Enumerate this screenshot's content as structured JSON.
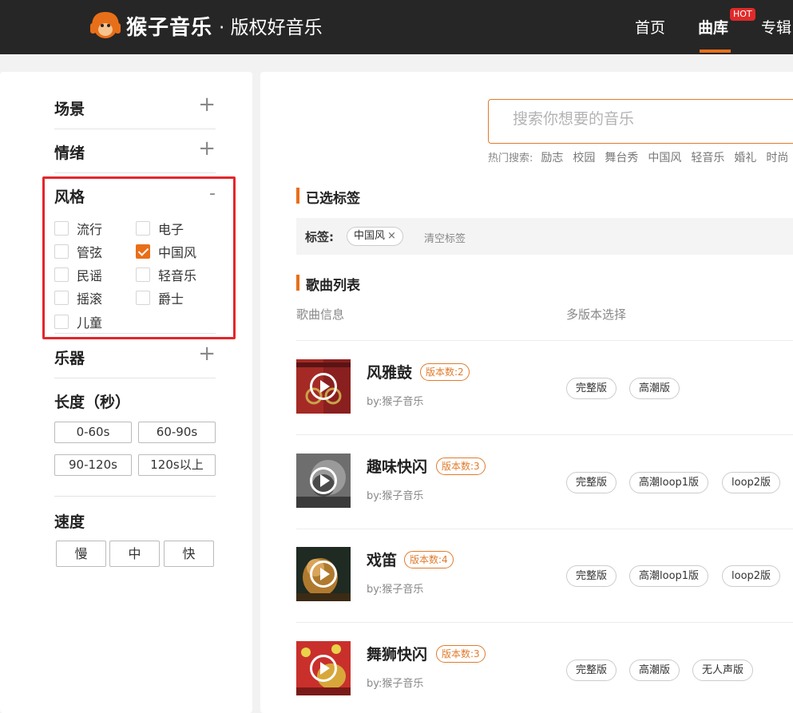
{
  "header": {
    "logo_text": "猴子音乐",
    "slogan": "· 版权好音乐",
    "nav": [
      "首页",
      "曲库",
      "专辑"
    ],
    "hot_badge": "HOT",
    "accent": "#e86f19"
  },
  "sidebar": {
    "scene": {
      "title": "场景",
      "toggle": "+"
    },
    "mood": {
      "title": "情绪",
      "toggle": "+"
    },
    "style": {
      "title": "风格",
      "toggle": "-",
      "options": [
        "流行",
        "电子",
        "管弦",
        "中国风",
        "民谣",
        "轻音乐",
        "摇滚",
        "爵士",
        "儿童"
      ],
      "checked": "中国风"
    },
    "instrument": {
      "title": "乐器",
      "toggle": "+"
    },
    "length": {
      "title": "长度（秒）",
      "options": [
        "0-60s",
        "60-90s",
        "90-120s",
        "120s以上"
      ]
    },
    "speed": {
      "title": "速度",
      "options": [
        "慢",
        "中",
        "快"
      ]
    }
  },
  "main": {
    "search_placeholder": "搜索你想要的音乐",
    "hot_label": "热门搜索:",
    "hot_words": [
      "励志",
      "校园",
      "舞台秀",
      "中国风",
      "轻音乐",
      "婚礼",
      "时尚"
    ],
    "selected_title": "已选标签",
    "tag_label": "标签:",
    "selected_tag": "中国风",
    "tag_close": "×",
    "clear_tags": "清空标签",
    "list_title": "歌曲列表",
    "col_info": "歌曲信息",
    "col_versions": "多版本选择",
    "songs": [
      {
        "name": "风雅鼓",
        "badge": "版本数:2",
        "by": "by:猴子音乐",
        "versions": [
          "完整版",
          "高潮版"
        ]
      },
      {
        "name": "趣味快闪",
        "badge": "版本数:3",
        "by": "by:猴子音乐",
        "versions": [
          "完整版",
          "高潮loop1版",
          "loop2版"
        ]
      },
      {
        "name": "戏笛",
        "badge": "版本数:4",
        "by": "by:猴子音乐",
        "versions": [
          "完整版",
          "高潮loop1版",
          "loop2版"
        ]
      },
      {
        "name": "舞狮快闪",
        "badge": "版本数:3",
        "by": "by:猴子音乐",
        "versions": [
          "完整版",
          "高潮版",
          "无人声版"
        ]
      }
    ]
  }
}
